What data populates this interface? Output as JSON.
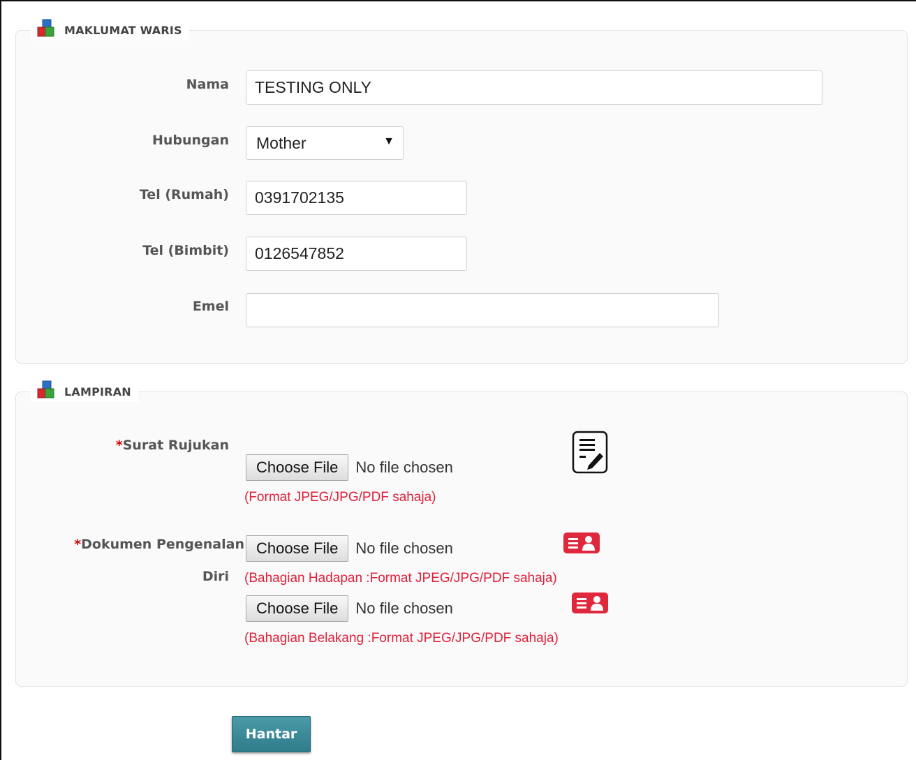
{
  "sections": {
    "waris": {
      "title": "MAKLUMAT WARIS",
      "fields": {
        "nama": {
          "label": "Nama",
          "value": "TESTING ONLY"
        },
        "hubungan": {
          "label": "Hubungan",
          "value": "Mother"
        },
        "tel_rumah": {
          "label": "Tel (Rumah)",
          "value": "0391702135"
        },
        "tel_bimbit": {
          "label": "Tel (Bimbit)",
          "value": "0126547852"
        },
        "emel": {
          "label": "Emel",
          "value": ""
        }
      }
    },
    "lampiran": {
      "title": "LAMPIRAN",
      "surat": {
        "required_mark": "*",
        "label": "Surat Rujukan",
        "button": "Choose File",
        "status": "No file chosen",
        "hint": "(Format JPEG/JPG/PDF sahaja)"
      },
      "dokumen": {
        "required_mark": "*",
        "label_line1": "Dokumen Pengenalan",
        "label_line2": "Diri",
        "front": {
          "button": "Choose File",
          "status": "No file chosen",
          "hint": "(Bahagian Hadapan :Format JPEG/JPG/PDF sahaja)"
        },
        "back": {
          "button": "Choose File",
          "status": "No file chosen",
          "hint": "(Bahagian Belakang :Format JPEG/JPG/PDF sahaja)"
        }
      }
    }
  },
  "submit_label": "Hantar",
  "icons": {
    "section": "blocks-icon",
    "surat": "document-edit-icon",
    "id_card": "id-card-icon"
  },
  "colors": {
    "hint": "#e0203a",
    "required": "#dd0000",
    "submit": "#3a8a98",
    "id_card": "#e0283c"
  }
}
